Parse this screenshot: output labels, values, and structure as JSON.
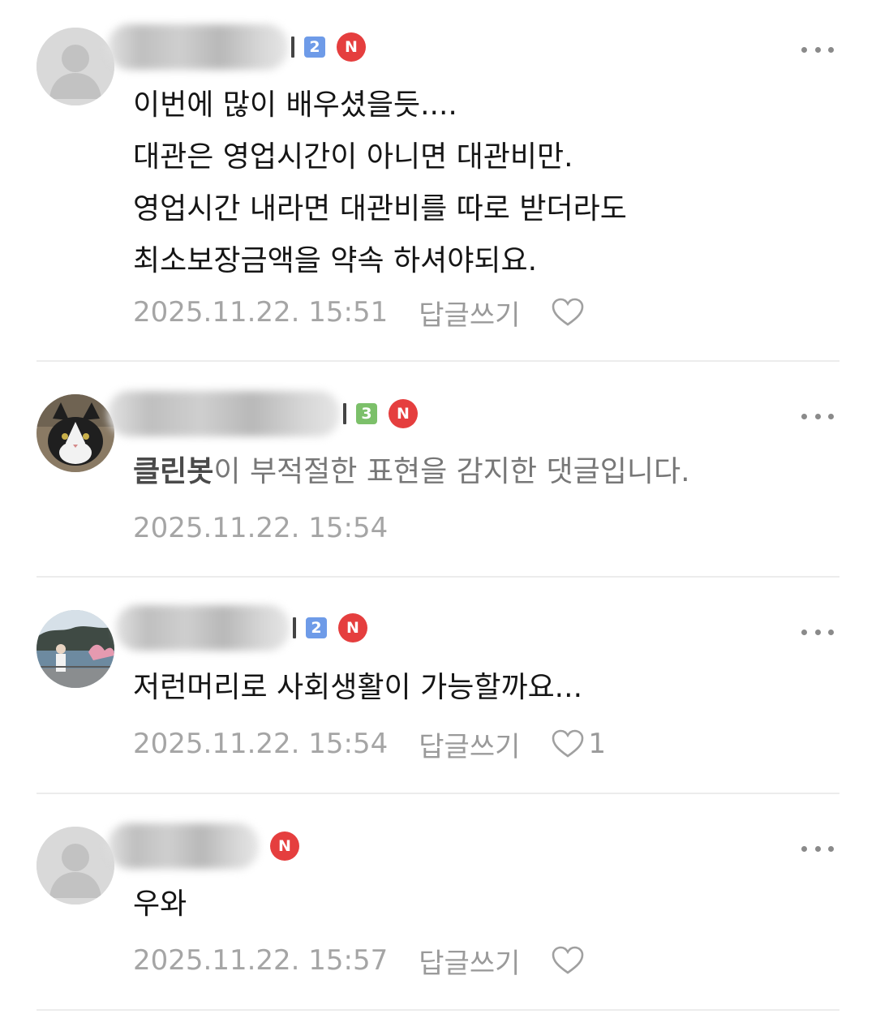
{
  "comments": [
    {
      "level": "2",
      "badge": "N",
      "lines": [
        "이번에 많이 배우셨을듯....",
        "대관은 영업시간이 아니면 대관비만.",
        "영업시간 내라면 대관비를 따로 받더라도",
        "최소보장금액을 약속 하셔야되요."
      ],
      "timestamp": "2025.11.22. 15:51",
      "reply_label": "답글쓰기",
      "likes": ""
    },
    {
      "level": "3",
      "badge": "N",
      "bot_name": "클린봇",
      "bot_message": "이 부적절한 표현을 감지한 댓글입니다.",
      "timestamp": "2025.11.22. 15:54"
    },
    {
      "level": "2",
      "badge": "N",
      "lines": [
        "저런머리로 사회생활이 가능할까요..."
      ],
      "timestamp": "2025.11.22. 15:54",
      "reply_label": "답글쓰기",
      "likes": "1"
    },
    {
      "badge": "N",
      "lines": [
        "우와"
      ],
      "timestamp": "2025.11.22. 15:57",
      "reply_label": "답글쓰기",
      "likes": ""
    }
  ],
  "colors": {
    "level_blue": "#6e9be8",
    "level_green": "#7cc06a",
    "new_badge": "#e53e3e",
    "meta_gray": "#a5a5a5"
  },
  "icons": [
    "default-avatar-icon",
    "more-options-icon",
    "heart-icon"
  ]
}
